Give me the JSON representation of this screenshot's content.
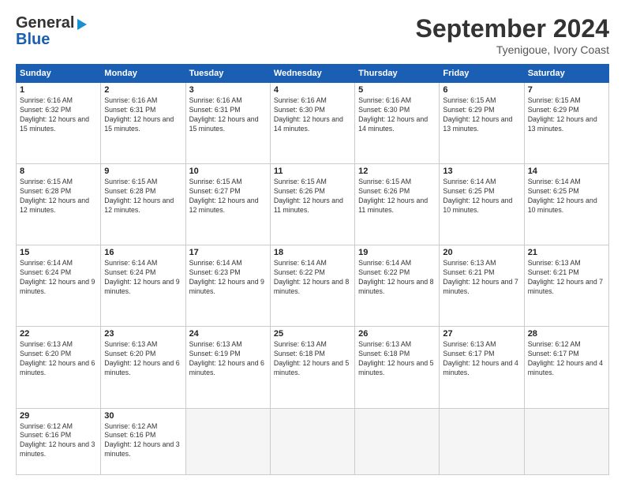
{
  "header": {
    "logo_line1": "General",
    "logo_line2": "Blue",
    "month": "September 2024",
    "location": "Tyenigoue, Ivory Coast"
  },
  "days_of_week": [
    "Sunday",
    "Monday",
    "Tuesday",
    "Wednesday",
    "Thursday",
    "Friday",
    "Saturday"
  ],
  "weeks": [
    [
      {
        "day": "1",
        "sunrise": "6:16 AM",
        "sunset": "6:32 PM",
        "daylight": "12 hours and 15 minutes."
      },
      {
        "day": "2",
        "sunrise": "6:16 AM",
        "sunset": "6:31 PM",
        "daylight": "12 hours and 15 minutes."
      },
      {
        "day": "3",
        "sunrise": "6:16 AM",
        "sunset": "6:31 PM",
        "daylight": "12 hours and 15 minutes."
      },
      {
        "day": "4",
        "sunrise": "6:16 AM",
        "sunset": "6:30 PM",
        "daylight": "12 hours and 14 minutes."
      },
      {
        "day": "5",
        "sunrise": "6:16 AM",
        "sunset": "6:30 PM",
        "daylight": "12 hours and 14 minutes."
      },
      {
        "day": "6",
        "sunrise": "6:15 AM",
        "sunset": "6:29 PM",
        "daylight": "12 hours and 13 minutes."
      },
      {
        "day": "7",
        "sunrise": "6:15 AM",
        "sunset": "6:29 PM",
        "daylight": "12 hours and 13 minutes."
      }
    ],
    [
      {
        "day": "8",
        "sunrise": "6:15 AM",
        "sunset": "6:28 PM",
        "daylight": "12 hours and 12 minutes."
      },
      {
        "day": "9",
        "sunrise": "6:15 AM",
        "sunset": "6:28 PM",
        "daylight": "12 hours and 12 minutes."
      },
      {
        "day": "10",
        "sunrise": "6:15 AM",
        "sunset": "6:27 PM",
        "daylight": "12 hours and 12 minutes."
      },
      {
        "day": "11",
        "sunrise": "6:15 AM",
        "sunset": "6:26 PM",
        "daylight": "12 hours and 11 minutes."
      },
      {
        "day": "12",
        "sunrise": "6:15 AM",
        "sunset": "6:26 PM",
        "daylight": "12 hours and 11 minutes."
      },
      {
        "day": "13",
        "sunrise": "6:14 AM",
        "sunset": "6:25 PM",
        "daylight": "12 hours and 10 minutes."
      },
      {
        "day": "14",
        "sunrise": "6:14 AM",
        "sunset": "6:25 PM",
        "daylight": "12 hours and 10 minutes."
      }
    ],
    [
      {
        "day": "15",
        "sunrise": "6:14 AM",
        "sunset": "6:24 PM",
        "daylight": "12 hours and 9 minutes."
      },
      {
        "day": "16",
        "sunrise": "6:14 AM",
        "sunset": "6:24 PM",
        "daylight": "12 hours and 9 minutes."
      },
      {
        "day": "17",
        "sunrise": "6:14 AM",
        "sunset": "6:23 PM",
        "daylight": "12 hours and 9 minutes."
      },
      {
        "day": "18",
        "sunrise": "6:14 AM",
        "sunset": "6:22 PM",
        "daylight": "12 hours and 8 minutes."
      },
      {
        "day": "19",
        "sunrise": "6:14 AM",
        "sunset": "6:22 PM",
        "daylight": "12 hours and 8 minutes."
      },
      {
        "day": "20",
        "sunrise": "6:13 AM",
        "sunset": "6:21 PM",
        "daylight": "12 hours and 7 minutes."
      },
      {
        "day": "21",
        "sunrise": "6:13 AM",
        "sunset": "6:21 PM",
        "daylight": "12 hours and 7 minutes."
      }
    ],
    [
      {
        "day": "22",
        "sunrise": "6:13 AM",
        "sunset": "6:20 PM",
        "daylight": "12 hours and 6 minutes."
      },
      {
        "day": "23",
        "sunrise": "6:13 AM",
        "sunset": "6:20 PM",
        "daylight": "12 hours and 6 minutes."
      },
      {
        "day": "24",
        "sunrise": "6:13 AM",
        "sunset": "6:19 PM",
        "daylight": "12 hours and 6 minutes."
      },
      {
        "day": "25",
        "sunrise": "6:13 AM",
        "sunset": "6:18 PM",
        "daylight": "12 hours and 5 minutes."
      },
      {
        "day": "26",
        "sunrise": "6:13 AM",
        "sunset": "6:18 PM",
        "daylight": "12 hours and 5 minutes."
      },
      {
        "day": "27",
        "sunrise": "6:13 AM",
        "sunset": "6:17 PM",
        "daylight": "12 hours and 4 minutes."
      },
      {
        "day": "28",
        "sunrise": "6:12 AM",
        "sunset": "6:17 PM",
        "daylight": "12 hours and 4 minutes."
      }
    ],
    [
      {
        "day": "29",
        "sunrise": "6:12 AM",
        "sunset": "6:16 PM",
        "daylight": "12 hours and 3 minutes."
      },
      {
        "day": "30",
        "sunrise": "6:12 AM",
        "sunset": "6:16 PM",
        "daylight": "12 hours and 3 minutes."
      },
      null,
      null,
      null,
      null,
      null
    ]
  ]
}
